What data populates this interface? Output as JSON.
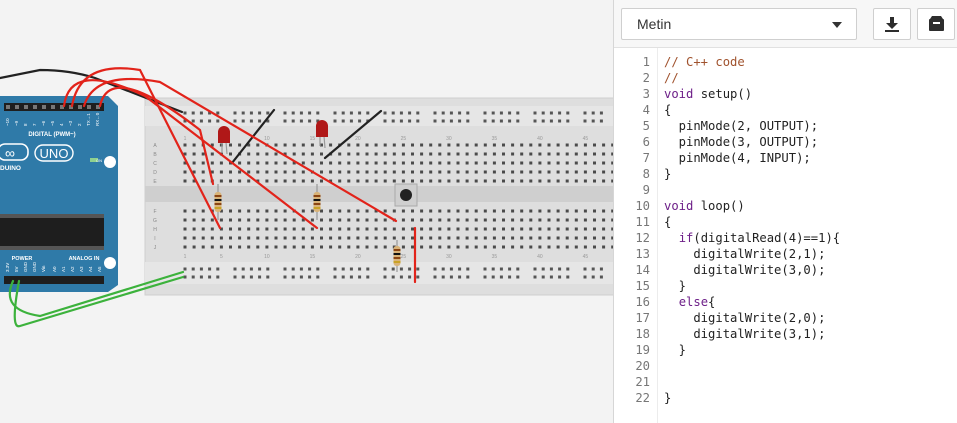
{
  "code_panel": {
    "mode": "Metin",
    "download_icon": "download-icon",
    "libraries_icon": "library-box-icon",
    "lines": [
      "// C++ code",
      "//",
      "void setup()",
      "{",
      "  pinMode(2, OUTPUT);",
      "  pinMode(3, OUTPUT);",
      "  pinMode(4, INPUT);",
      "}",
      "",
      "void loop()",
      "{",
      "  if(digitalRead(4)==1){",
      "    digitalWrite(2,1);",
      "    digitalWrite(3,0);",
      "  }",
      "  else{",
      "    digitalWrite(2,0);",
      "    digitalWrite(3,1);",
      "  }",
      "",
      "",
      "}"
    ],
    "line_numbers": [
      "1",
      "2",
      "3",
      "4",
      "5",
      "6",
      "7",
      "8",
      "9",
      "10",
      "11",
      "12",
      "13",
      "14",
      "15",
      "16",
      "17",
      "18",
      "19",
      "20",
      "21",
      "22"
    ]
  },
  "arduino": {
    "brand": "UNO",
    "brand_partial": "DUINO",
    "header_digital": "DIGITAL (PWM~)",
    "header_power": "POWER",
    "header_analog": "ANALOG IN",
    "digital_pins": [
      "~10",
      "~9",
      "8",
      "7",
      "~6",
      "~5",
      "4",
      "~3",
      "2",
      "TX→1",
      "RX←0"
    ],
    "power_pins": [
      "3.3V",
      "5V",
      "GND",
      "GND",
      "Vin"
    ],
    "analog_pins": [
      "A0",
      "A1",
      "A2",
      "A3",
      "A4",
      "A5"
    ],
    "on_label": "ON"
  },
  "breadboard": {
    "column_numbers": [
      "1",
      "5",
      "10",
      "15",
      "20",
      "25",
      "30",
      "35",
      "40",
      "45"
    ],
    "row_letters_top": [
      "A",
      "B",
      "C",
      "D",
      "E"
    ],
    "row_letters_bottom": [
      "F",
      "G",
      "H",
      "I",
      "J"
    ]
  },
  "colors": {
    "wire_red": "#e2231a",
    "wire_black": "#222222",
    "wire_green": "#3cb23c",
    "arduino_blue": "#2f7aa8",
    "led_red": "#b01818",
    "code_comment": "#a0522d",
    "code_keyword": "#6d1f88"
  }
}
